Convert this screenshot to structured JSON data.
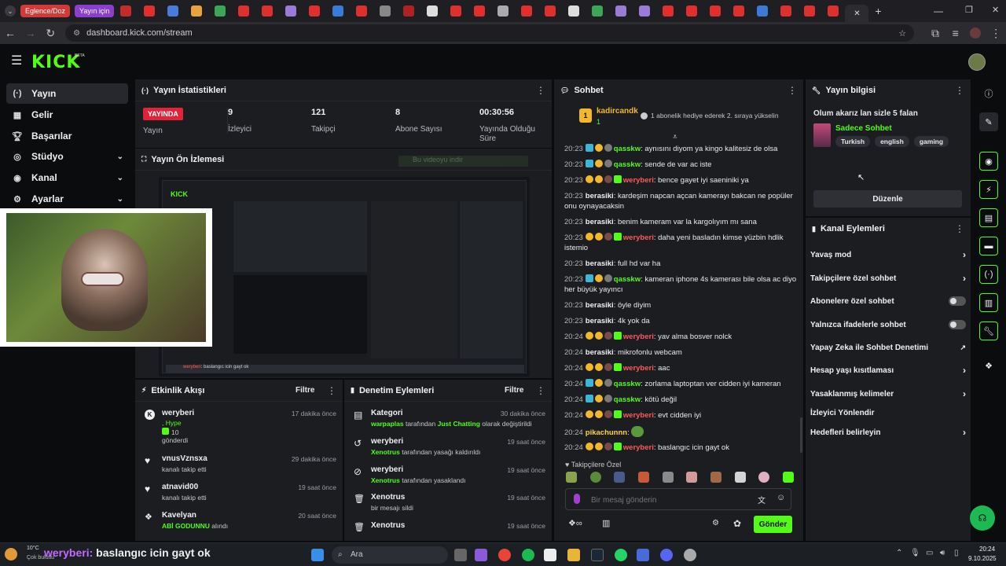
{
  "browser": {
    "tab_chips": [
      "Eglence/Doz",
      "Yayın için"
    ],
    "url": "dashboard.kick.com/stream"
  },
  "brand": {
    "logo": "KICK",
    "beta": "BETA",
    "accent": "#53fc18"
  },
  "sidebar": {
    "items": [
      {
        "icon": "broadcast-icon",
        "label": "Yayın"
      },
      {
        "icon": "revenue-icon",
        "label": "Gelir"
      },
      {
        "icon": "trophy-icon",
        "label": "Başarılar"
      },
      {
        "icon": "studio-icon",
        "label": "Stüdyo"
      },
      {
        "icon": "channel-icon",
        "label": "Kanal"
      },
      {
        "icon": "settings-icon",
        "label": "Ayarlar"
      }
    ]
  },
  "stats": {
    "title": "Yayın İstatistikleri",
    "live_badge": "YAYINDA",
    "live_label": "Yayın",
    "viewers": {
      "value": "9",
      "label": "İzleyici"
    },
    "followers": {
      "value": "121",
      "label": "Takipçi"
    },
    "subs": {
      "value": "8",
      "label": "Abone Sayısı"
    },
    "uptime": {
      "value": "00:30:56",
      "label": "Yayında Olduğu Süre"
    }
  },
  "preview": {
    "title": "Yayın Ön İzlemesi",
    "download_hint": "Bu videoyu indir",
    "overlay_name": "weryberi",
    "overlay_msg": "baslangıc icin gayt ok"
  },
  "events": {
    "title": "Etkinlik Akışı",
    "filter": "Filtre",
    "rows": [
      {
        "name": "weryberi",
        "line1": ", Hype",
        "line2": "10",
        "line3": "gönderdi",
        "time": "17 dakika önce"
      },
      {
        "name": "vnusVznsxa",
        "line1": "kanalı takip etti",
        "time": "29 dakika önce"
      },
      {
        "name": "atnavid00",
        "line1": "kanalı takip etti",
        "time": "19 saat önce"
      },
      {
        "name": "Kavelyan",
        "line1": "ABİ GODUNNU",
        "line2": "alındı",
        "time": "20 saat önce"
      }
    ]
  },
  "moderation": {
    "title": "Denetim Eylemleri",
    "filter": "Filtre",
    "rows": [
      {
        "name": "Kategori",
        "actor": "warpaplas",
        "text": "tarafından",
        "target": "Just Chatting",
        "tail": "olarak değiştirildi",
        "time": "30 dakika önce"
      },
      {
        "name": "weryberi",
        "actor": "Xenotrus",
        "text": "tarafından yasağı kaldırıldı",
        "time": "19 saat önce"
      },
      {
        "name": "weryberi",
        "actor": "Xenotrus",
        "text": "tarafından yasaklandı",
        "time": "19 saat önce"
      },
      {
        "name": "Xenotrus",
        "text": "bir mesajı sildi",
        "time": "19 saat önce"
      },
      {
        "name": "Xenotrus",
        "text": "",
        "time": "19 saat önce"
      }
    ]
  },
  "chat": {
    "title": "Sohbet",
    "pinned_user": "kadircandk",
    "pinned_count": "1",
    "pinned_msg": "1 abonelik hediye ederek 2. sıraya yükselin",
    "messages": [
      {
        "time": "20:23",
        "user": "qasskw",
        "text": "aynısını diyom ya kingo kalitesiz de olsa",
        "color": "#53fc18"
      },
      {
        "time": "20:23",
        "user": "qasskw",
        "text": "sende de var ac iste",
        "color": "#53fc18"
      },
      {
        "time": "20:23",
        "user": "weryberi",
        "text": "bence gayet iyi saeniniki ya",
        "color": "#ff5a5a"
      },
      {
        "time": "20:23",
        "user": "berasiki",
        "text": "kardeşim napcan açcan kamerayı bakcan ne popüler onu oynayacaksin",
        "color": "#f0f0f0"
      },
      {
        "time": "20:23",
        "user": "berasiki",
        "text": "benim kameram var la kargolıyım mı sana",
        "color": "#f0f0f0"
      },
      {
        "time": "20:23",
        "user": "weryberi",
        "text": "daha yeni basladın kimse yüzbin hdlik istemio",
        "color": "#ff5a5a"
      },
      {
        "time": "20:23",
        "user": "berasiki",
        "text": "full hd var ha",
        "color": "#f0f0f0"
      },
      {
        "time": "20:23",
        "user": "qasskw",
        "text": "kameran iphone 4s kamerası bile olsa ac diyo her büyük yayıncı",
        "color": "#53fc18"
      },
      {
        "time": "20:23",
        "user": "berasiki",
        "text": "öyle diyim",
        "color": "#f0f0f0"
      },
      {
        "time": "20:23",
        "user": "berasiki",
        "text": "4k yok da",
        "color": "#f0f0f0"
      },
      {
        "time": "20:24",
        "user": "weryberi",
        "text": "yav alma bosver nolck",
        "color": "#ff5a5a"
      },
      {
        "time": "20:24",
        "user": "berasiki",
        "text": "mikrofonlu webcam",
        "color": "#f0f0f0"
      },
      {
        "time": "20:24",
        "user": "weryberi",
        "text": "aac",
        "color": "#ff5a5a"
      },
      {
        "time": "20:24",
        "user": "qasskw",
        "text": "zorlama laptoptan ver cidden iyi kameran",
        "color": "#53fc18"
      },
      {
        "time": "20:24",
        "user": "qasskw",
        "text": "kötü değil",
        "color": "#53fc18"
      },
      {
        "time": "20:24",
        "user": "weryberi",
        "text": "evt cidden iyi",
        "color": "#ff5a5a"
      },
      {
        "time": "20:24",
        "user": "pikachunnn",
        "text": "",
        "color": "#ffd23f"
      },
      {
        "time": "20:24",
        "user": "weryberi",
        "text": "baslangıc icin gayt ok",
        "color": "#ff5a5a"
      }
    ],
    "followers_only": "Takipçilere Özel",
    "placeholder": "Bir mesaj gönderin",
    "send": "Gönder"
  },
  "info": {
    "title": "Yayın bilgisi",
    "stream_title": "Olum akarız lan sizle 5 falan",
    "category": "Sadece Sohbet",
    "tags": [
      "Turkish",
      "english",
      "gaming"
    ],
    "edit": "Düzenle"
  },
  "actions": {
    "title": "Kanal Eylemleri",
    "rows": [
      {
        "label": "Yavaş mod",
        "control": "chevron"
      },
      {
        "label": "Takipçilere özel sohbet",
        "control": "chevron"
      },
      {
        "label": "Abonelere özel sohbet",
        "control": "toggle"
      },
      {
        "label": "Yalnızca ifadelerle sohbet",
        "control": "toggle"
      },
      {
        "label": "Yapay Zeka ile Sohbet Denetimi",
        "control": "external"
      },
      {
        "label": "Hesap yaşı kısıtlaması",
        "control": "chevron"
      },
      {
        "label": "Yasaklanmış kelimeler",
        "control": "chevron"
      },
      {
        "label": "İzleyici Yönlendir",
        "control": "none"
      },
      {
        "label": "Hedefleri belirleyin",
        "control": "chevron"
      }
    ]
  },
  "taskbar": {
    "weather": "10°C",
    "weather_desc": "Çok bulutlu",
    "overlay_user": "weryberi:",
    "overlay_msg": "baslangıc icin gayt ok",
    "search": "Ara",
    "time": "20:24",
    "date": "9.10.2025"
  }
}
